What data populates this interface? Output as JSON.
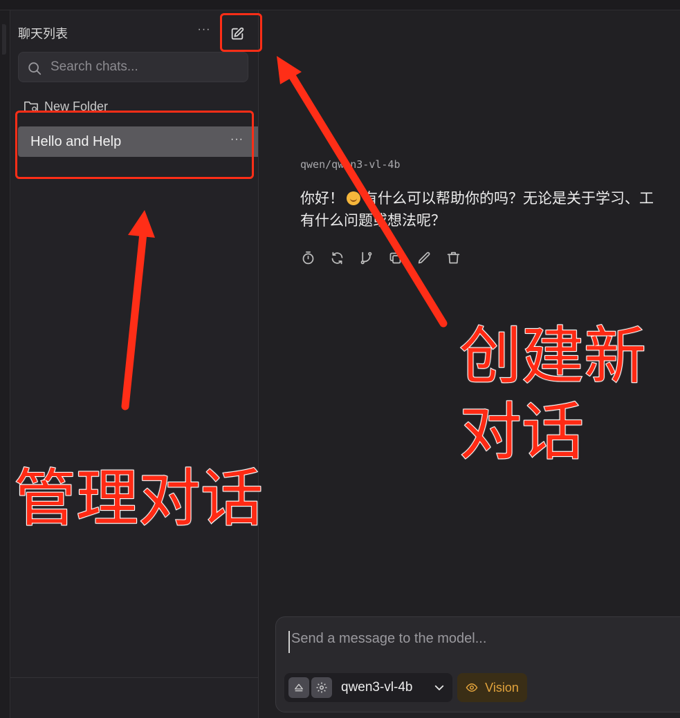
{
  "sidebar": {
    "title": "聊天列表",
    "more_glyph": "···",
    "search_placeholder": "Search chats...",
    "folder_label": "New Folder",
    "chats": [
      {
        "label": "Hello and Help",
        "more_glyph": "···"
      }
    ]
  },
  "conversation": {
    "model_name": "qwen/qwen3-vl-4b",
    "message_line1_a": "你好！",
    "message_line1_b": "有什么可以帮助你的吗？无论是关于学习、工",
    "message_line2": "有什么问题或想法呢？",
    "actions": [
      "timer-icon",
      "regenerate-icon",
      "branch-icon",
      "copy-icon",
      "edit-icon",
      "delete-icon"
    ]
  },
  "composer": {
    "placeholder": "Send a message to the model...",
    "model_label": "qwen3-vl-4b",
    "vision_label": "Vision"
  },
  "annotations": {
    "new_chat_text_line1": "创建新",
    "new_chat_text_line2": "对话",
    "manage_text": "管理对话",
    "color": "#ff2e17"
  },
  "theme": {
    "background": "#212023",
    "sidebar": "#232226",
    "selected": "#5a595d",
    "accent": "#e2a33c"
  }
}
